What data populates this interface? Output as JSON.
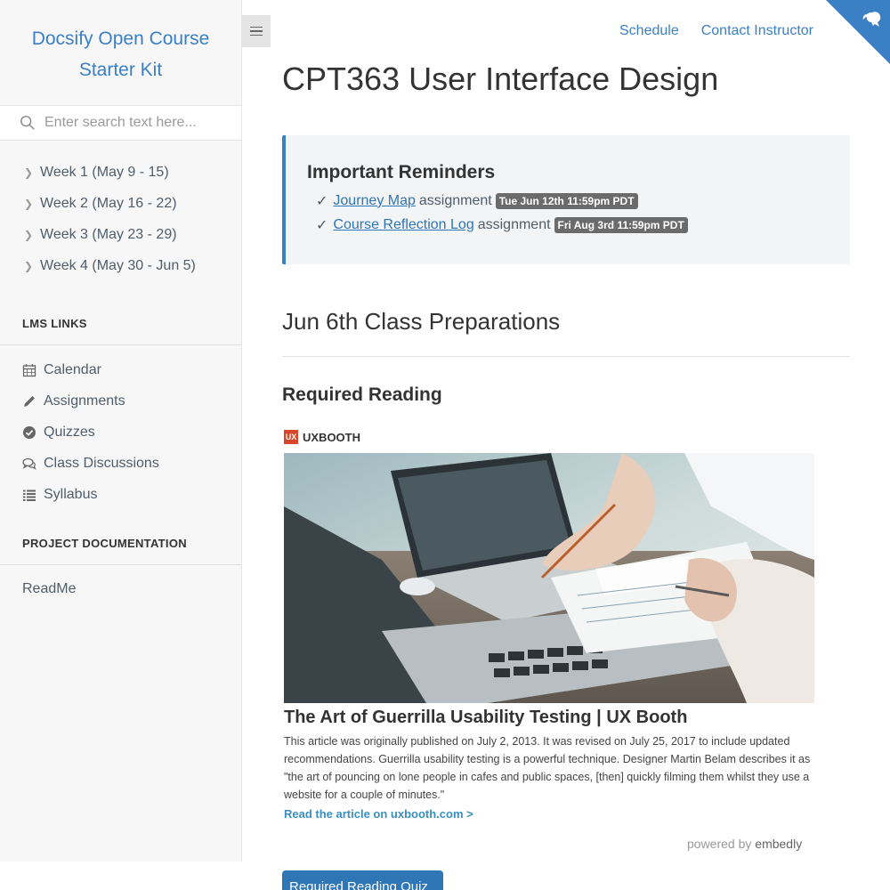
{
  "sidebar": {
    "app_name": "Docsify Open Course Starter Kit",
    "search_placeholder": "Enter search text here...",
    "weeks": [
      {
        "label": "Week 1 (May 9 - 15)"
      },
      {
        "label": "Week 2 (May 16 - 22)"
      },
      {
        "label": "Week 3 (May 23 - 29)"
      },
      {
        "label": "Week 4 (May 30 - Jun 5)"
      }
    ],
    "lms_title": "LMS LINKS",
    "lms_items": [
      {
        "label": "Calendar",
        "icon": "calendar-icon"
      },
      {
        "label": "Assignments",
        "icon": "pencil-icon"
      },
      {
        "label": "Quizzes",
        "icon": "check-circle-icon"
      },
      {
        "label": "Class Discussions",
        "icon": "comments-icon"
      },
      {
        "label": "Syllabus",
        "icon": "list-icon"
      }
    ],
    "project_title": "PROJECT DOCUMENTATION",
    "readme_label": "ReadMe"
  },
  "nav": {
    "schedule": "Schedule",
    "contact": "Contact Instructor"
  },
  "main": {
    "title": "CPT363 User Interface Design",
    "reminders": {
      "title": "Important Reminders",
      "items": [
        {
          "link": "Journey Map",
          "suffix": "assignment",
          "due": "Tue Jun 12th 11:59pm PDT"
        },
        {
          "link": "Course Reflection Log",
          "suffix": "assignment",
          "due": "Fri Aug 3rd 11:59pm PDT"
        }
      ]
    },
    "prep_title": "Jun 6th Class Preparations",
    "reading_title": "Required Reading",
    "embed": {
      "provider": "UXBOOTH",
      "provider_logo": "UX",
      "article_title": "The Art of Guerrilla Usability Testing | UX Booth",
      "description": "This article was originally published on July 2, 2013. It was revised on July 25, 2017 to include updated recommendations. Guerrilla usability testing is a powerful technique. Designer Martin Belam describes it as \"the art of pouncing on lone people in cafes and public spaces, [then] quickly filming them whilst they use a website for a couple of minutes.\"",
      "read_more": "Read the article on uxbooth.com >",
      "powered_by": "powered by",
      "powered_brand": "embedly"
    },
    "quiz_button": "Required Reading Quiz"
  },
  "colors": {
    "accent": "#3b7fc4",
    "sidebar_bg": "#f7f7f7",
    "badge_bg": "#6b6b6b",
    "button_bg": "#2f76b7"
  }
}
